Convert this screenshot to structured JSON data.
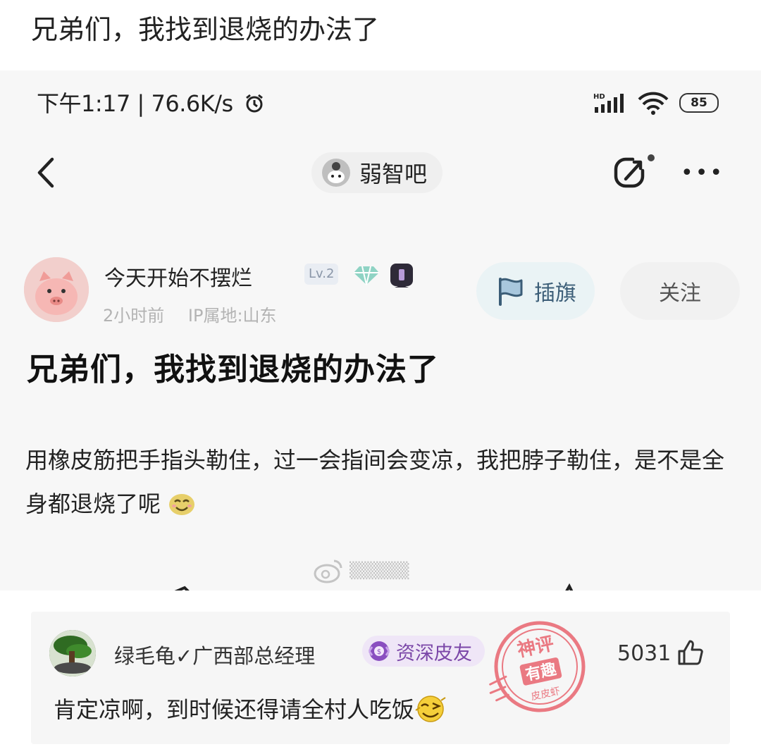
{
  "page": {
    "title": "兄弟们，我找到退烧的办法了"
  },
  "status_bar": {
    "time_speed": "下午1:17 | 76.6K/s",
    "network_label": "HD",
    "battery": "85"
  },
  "nav": {
    "forum_name": "弱智吧"
  },
  "author": {
    "name": "今天开始不摆烂",
    "level": "Lv.2",
    "time": "2小时前",
    "ip": "IP属地:山东",
    "flag_label": "插旗",
    "follow_label": "关注"
  },
  "post": {
    "title": "兄弟们，我找到退烧的办法了",
    "body": "用橡皮筋把手指头勒住，过一会指间会变凉，我把脖子勒住，是不是全身都退烧了呢"
  },
  "comment": {
    "user": "绿毛龟✓广西部总经理",
    "rank": "资深皮友",
    "likes": "5031",
    "text": "肯定凉啊，到时候还得请全村人吃饭"
  },
  "stamp": {
    "line1": "神评",
    "line2": "有趣",
    "line3": "皮皮虾"
  },
  "colors": {
    "accent_purple": "#7b47a8",
    "stamp_red": "#e8646e",
    "flag_blue": "#3b5d77"
  }
}
